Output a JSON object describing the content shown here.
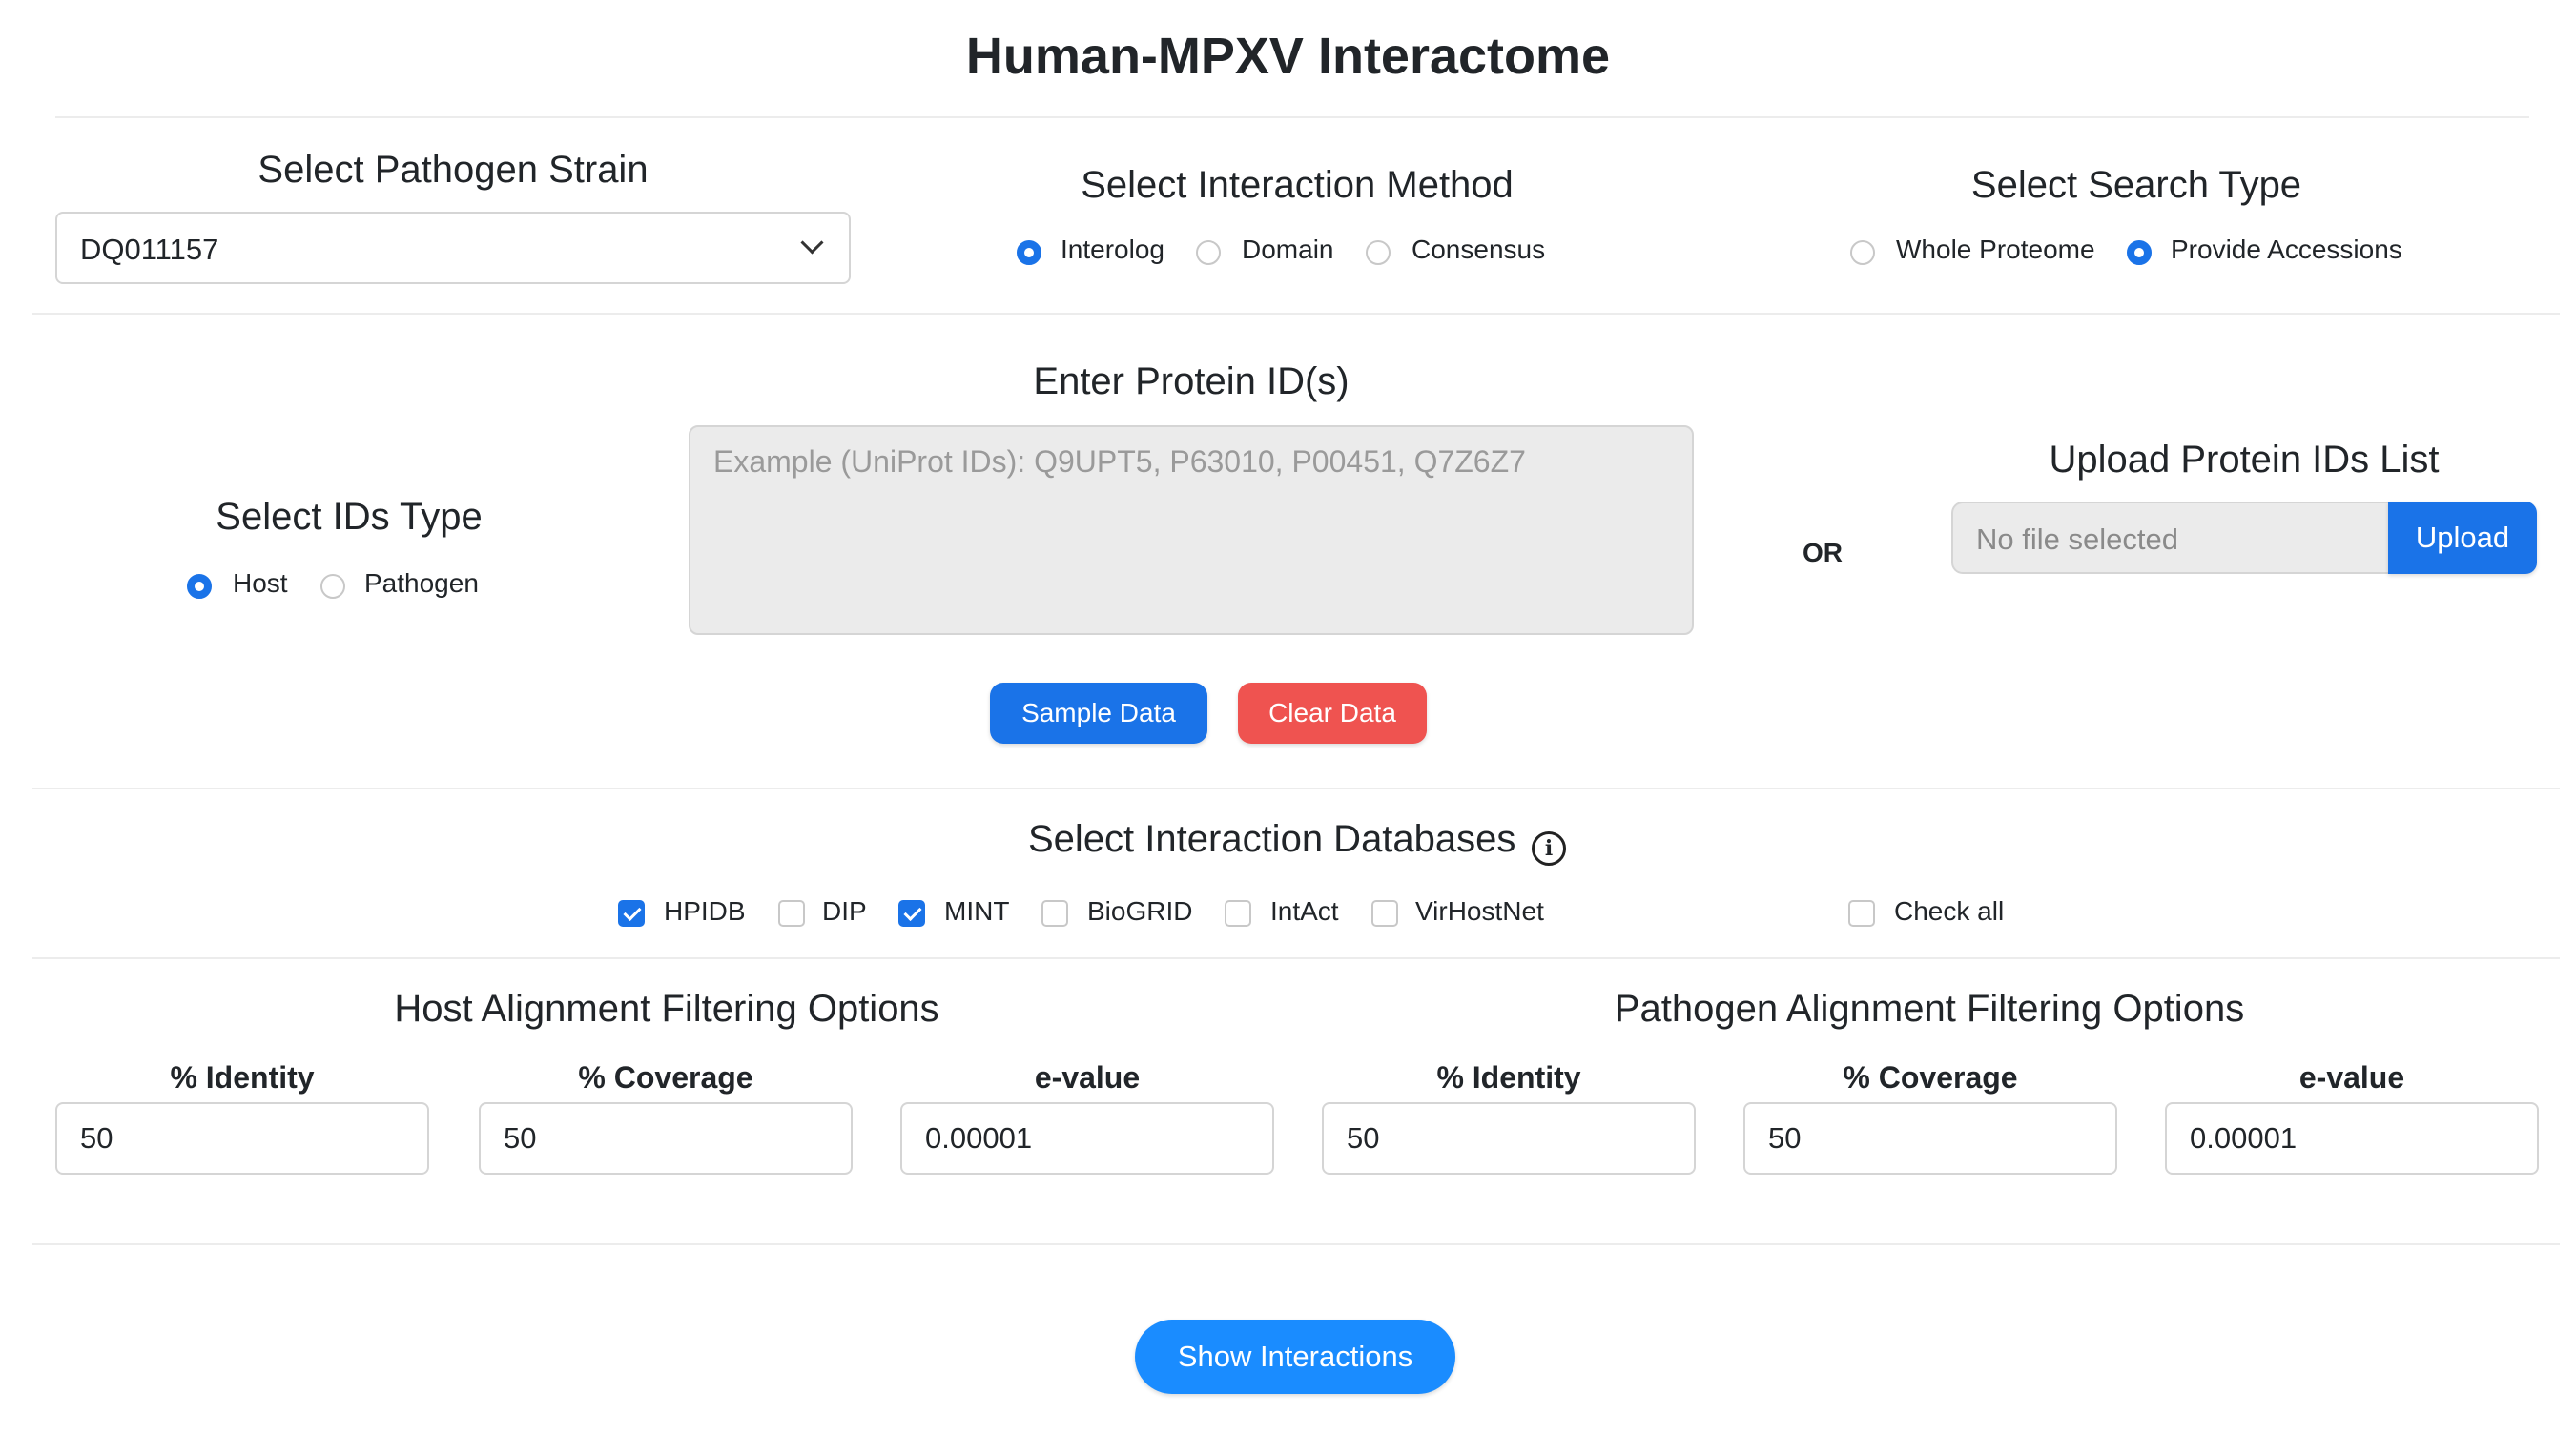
{
  "page_title": "Human-MPXV Interactome",
  "strain": {
    "heading": "Select Pathogen Strain",
    "selected": "DQ011157"
  },
  "method": {
    "heading": "Select Interaction Method",
    "options": [
      {
        "label": "Interolog",
        "checked": true
      },
      {
        "label": "Domain",
        "checked": false
      },
      {
        "label": "Consensus",
        "checked": false
      }
    ]
  },
  "search_type": {
    "heading": "Select Search Type",
    "options": [
      {
        "label": "Whole Proteome",
        "checked": false
      },
      {
        "label": "Provide Accessions",
        "checked": true
      }
    ]
  },
  "ids_type": {
    "heading": "Select IDs Type",
    "options": [
      {
        "label": "Host",
        "checked": true
      },
      {
        "label": "Pathogen",
        "checked": false
      }
    ]
  },
  "protein_input": {
    "heading": "Enter Protein ID(s)",
    "placeholder": "Example (UniProt IDs): Q9UPT5, P63010, P00451, Q7Z6Z7",
    "value": ""
  },
  "or_label": "OR",
  "upload": {
    "heading": "Upload Protein IDs List",
    "file_status": "No file selected",
    "button_label": "Upload"
  },
  "buttons": {
    "sample": "Sample Data",
    "clear": "Clear Data",
    "show": "Show Interactions"
  },
  "databases": {
    "heading": "Select Interaction Databases",
    "items": [
      {
        "label": "HPIDB",
        "checked": true
      },
      {
        "label": "DIP",
        "checked": false
      },
      {
        "label": "MINT",
        "checked": true
      },
      {
        "label": "BioGRID",
        "checked": false
      },
      {
        "label": "IntAct",
        "checked": false
      },
      {
        "label": "VirHostNet",
        "checked": false
      }
    ],
    "check_all": {
      "label": "Check all",
      "checked": false
    }
  },
  "host_filter": {
    "heading": "Host Alignment Filtering Options",
    "fields": [
      {
        "label": "% Identity",
        "value": "50"
      },
      {
        "label": "% Coverage",
        "value": "50"
      },
      {
        "label": "e-value",
        "value": "0.00001"
      }
    ]
  },
  "pathogen_filter": {
    "heading": "Pathogen Alignment Filtering Options",
    "fields": [
      {
        "label": "% Identity",
        "value": "50"
      },
      {
        "label": "% Coverage",
        "value": "50"
      },
      {
        "label": "e-value",
        "value": "0.00001"
      }
    ]
  },
  "colors": {
    "primary": "#1a73e8",
    "danger": "#ef5350",
    "show_button": "#1a8cff",
    "textarea_bg": "#ebebeb"
  }
}
